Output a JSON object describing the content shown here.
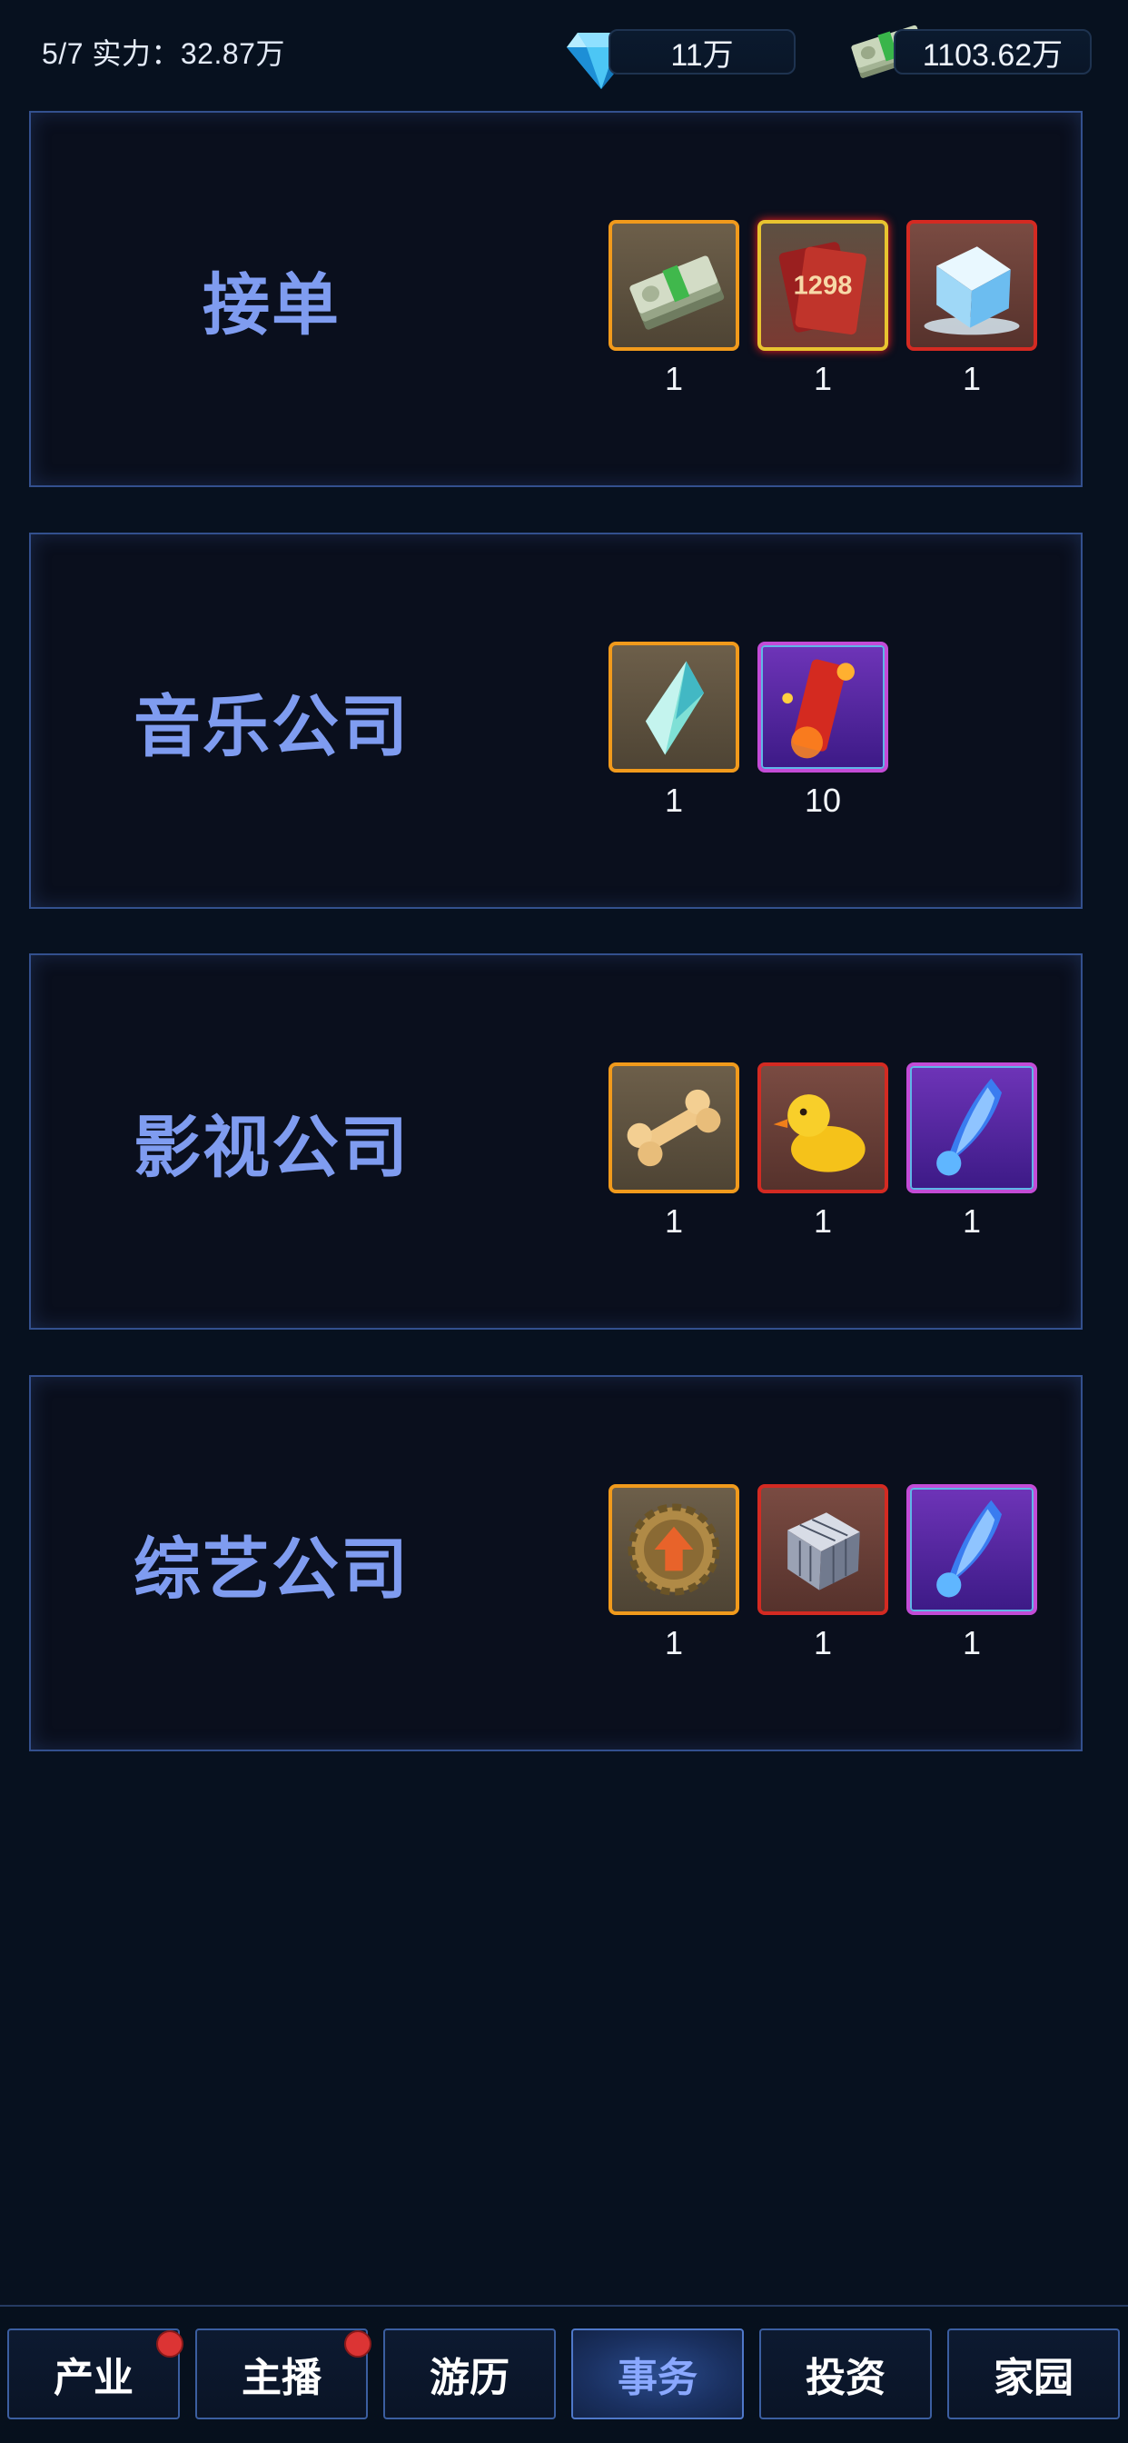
{
  "header": {
    "progress_text": "5/7  实力：32.87万",
    "diamond_amount": "11万",
    "cash_amount": "1103.62万",
    "diamond_icon": "diamond-icon",
    "cash_icon": "cash-stack-icon"
  },
  "cards": [
    {
      "title": "接单",
      "rewards": [
        {
          "icon": "cash-stack-icon",
          "qty": "1",
          "frame": "orange"
        },
        {
          "icon": "red-card-1298-icon",
          "qty": "1",
          "frame": "red-glow",
          "label": "1298"
        },
        {
          "icon": "ice-cube-icon",
          "qty": "1",
          "frame": "red"
        }
      ]
    },
    {
      "title": "音乐公司",
      "rewards": [
        {
          "icon": "crystal-shard-icon",
          "qty": "1",
          "frame": "orange"
        },
        {
          "icon": "red-firework-icon",
          "qty": "10",
          "frame": "purple"
        }
      ]
    },
    {
      "title": "影视公司",
      "rewards": [
        {
          "icon": "bone-icon",
          "qty": "1",
          "frame": "orange"
        },
        {
          "icon": "rubber-duck-icon",
          "qty": "1",
          "frame": "red"
        },
        {
          "icon": "blue-flame-feather-icon",
          "qty": "1",
          "frame": "purple"
        }
      ]
    },
    {
      "title": "综艺公司",
      "rewards": [
        {
          "icon": "gear-upgrade-icon",
          "qty": "1",
          "frame": "orange"
        },
        {
          "icon": "silver-cube-icon",
          "qty": "1",
          "frame": "red"
        },
        {
          "icon": "blue-flame-feather-icon",
          "qty": "1",
          "frame": "purple"
        }
      ]
    }
  ],
  "nav": {
    "tabs": [
      {
        "label": "产业",
        "badge": true
      },
      {
        "label": "主播",
        "badge": true
      },
      {
        "label": "游历",
        "badge": false
      },
      {
        "label": "事务",
        "badge": false,
        "active": true
      },
      {
        "label": "投资",
        "badge": false
      },
      {
        "label": "家园",
        "badge": false
      }
    ]
  },
  "colors": {
    "background": "#07111f",
    "card_title": "#7f9cf0",
    "card_border": "#33508e",
    "badge": "#dc3434",
    "active_tab_text": "#8aa8ff"
  }
}
